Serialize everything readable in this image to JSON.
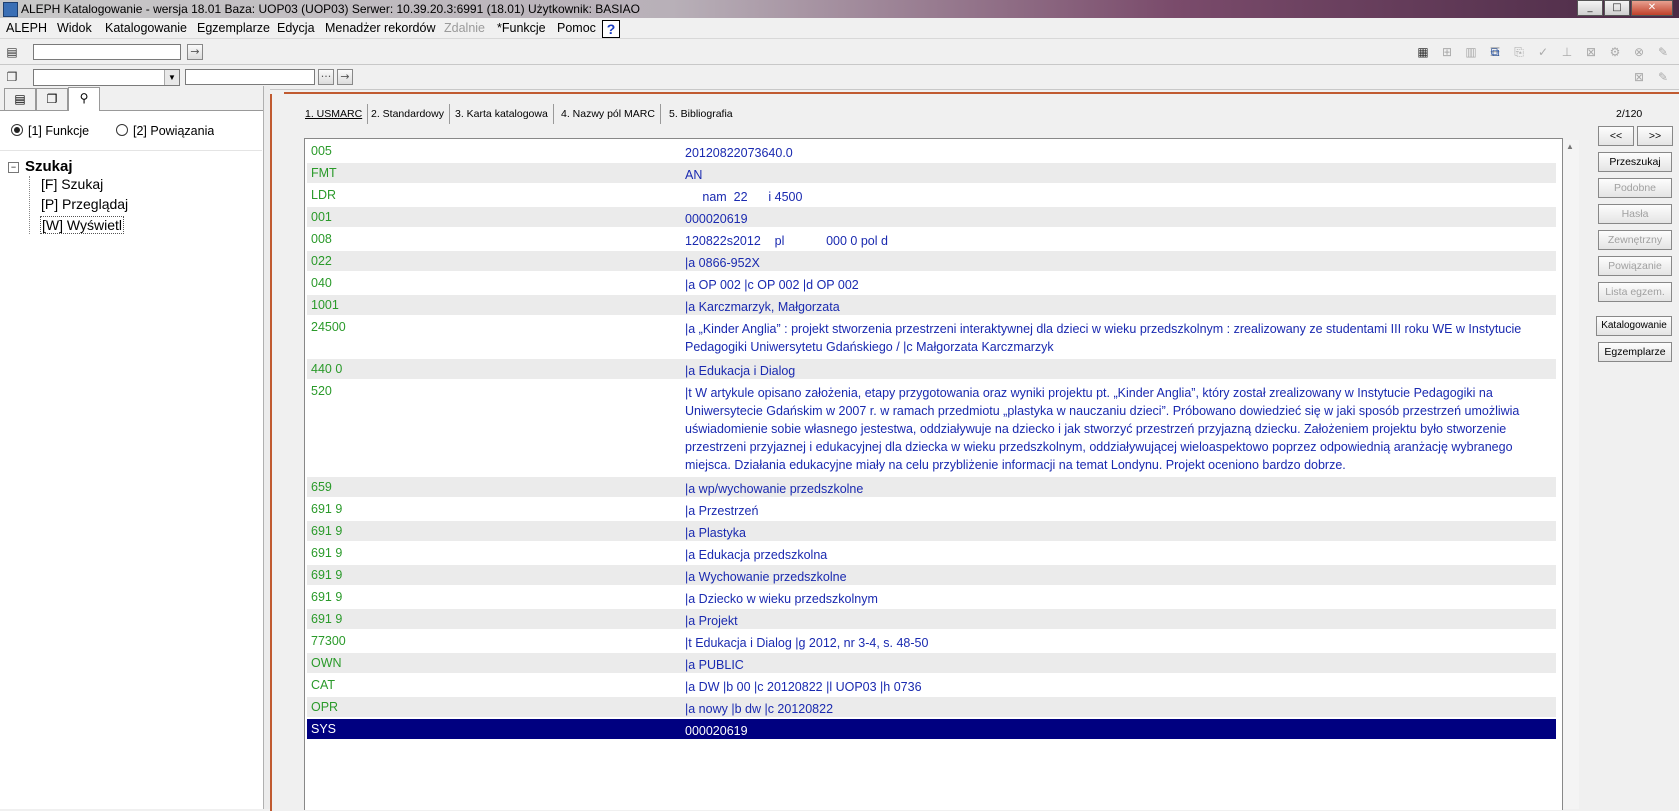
{
  "window": {
    "title": "ALEPH Katalogowanie - wersja 18.01  Baza:  UOP03 (UOP03)  Serwer:  10.39.20.3:6991 (18.01)  Użytkownik:  BASIAO",
    "minimize": "_",
    "restore": "□",
    "close": "✕"
  },
  "menu": {
    "items": [
      "ALEPH",
      "Widok",
      "Katalogowanie",
      "Egzemplarze",
      "Edycja",
      "Menadżer rekordów",
      "Zdalnie",
      "*Funkcje",
      "Pomoc"
    ],
    "help": "?"
  },
  "toolbar": {
    "go_arrow": "→",
    "ellipsis": "···"
  },
  "left": {
    "radio1": "[1] Funkcje",
    "radio2": "[2] Powiązania",
    "tree_root": "Szukaj",
    "tree_items": [
      "[F] Szukaj",
      "[P] Przeglądaj",
      "[W] Wyświetl"
    ]
  },
  "tabs": [
    "1. USMARC",
    "2. Standardowy",
    "3. Karta katalogowa",
    "4. Nazwy pól MARC",
    "5. Bibliografia"
  ],
  "records": [
    {
      "tag": "005",
      "value": "20120822073640.0"
    },
    {
      "tag": "FMT",
      "value": "AN"
    },
    {
      "tag": "LDR",
      "value": "     nam  22      i 4500"
    },
    {
      "tag": "001",
      "value": "000020619"
    },
    {
      "tag": "008",
      "value": "120822s2012    pl            000 0 pol d"
    },
    {
      "tag": "022",
      "value": "|a 0866-952X"
    },
    {
      "tag": "040",
      "value": "|a OP 002 |c OP 002 |d OP 002"
    },
    {
      "tag": "1001",
      "value": "|a Karczmarzyk, Małgorzata"
    },
    {
      "tag": "24500",
      "value": "|a „Kinder Anglia” : projekt stworzenia przestrzeni interaktywnej dla dzieci w wieku przedszkolnym : zrealizowany ze studentami III roku WE w Instytucie Pedagogiki Uniwersytetu Gdańskiego / |c Małgorzata Karczmarzyk"
    },
    {
      "tag": "440 0",
      "value": "|a Edukacja i Dialog"
    },
    {
      "tag": "520",
      "value": "|t W artykule opisano założenia, etapy przygotowania oraz wyniki projektu pt. „Kinder Anglia”, który został zrealizowany w Instytucie Pedagogiki na Uniwersytecie Gdańskim w 2007 r. w ramach przedmiotu „plastyka w nauczaniu dzieci”. Próbowano dowiedzieć się w jaki sposób przestrzeń umożliwia uświadomienie sobie własnego jestestwa, oddziaływuje na dziecko i jak stworzyć przestrzeń przyjazną dziecku. Założeniem projektu było stworzenie przestrzeni przyjaznej i edukacyjnej dla dziecka w wieku przedszkolnym, oddziaływującej wieloaspektowo poprzez odpowiednią aranżację wybranego miejsca. Działania edukacyjne miały na celu przybliżenie informacji na temat Londynu. Projekt oceniono bardzo dobrze."
    },
    {
      "tag": "659",
      "value": "|a wp/wychowanie przedszkolne"
    },
    {
      "tag": "691 9",
      "value": "|a Przestrzeń"
    },
    {
      "tag": "691 9",
      "value": "|a Plastyka"
    },
    {
      "tag": "691 9",
      "value": "|a Edukacja przedszkolna"
    },
    {
      "tag": "691 9",
      "value": "|a Wychowanie przedszkolne"
    },
    {
      "tag": "691 9",
      "value": "|a Dziecko w wieku przedszkolnym"
    },
    {
      "tag": "691 9",
      "value": "|a Projekt"
    },
    {
      "tag": "77300",
      "value": "|t Edukacja i Dialog |g 2012, nr 3-4, s. 48-50"
    },
    {
      "tag": "OWN",
      "value": "|a PUBLIC"
    },
    {
      "tag": "CAT",
      "value": "|a DW |b 00 |c 20120822 |l UOP03 |h 0736"
    },
    {
      "tag": "OPR",
      "value": "|a nowy |b dw |c 20120822"
    },
    {
      "tag": "SYS",
      "value": "000020619"
    }
  ],
  "right": {
    "count": "2/120",
    "prev": "<<",
    "next": ">>",
    "buttons": [
      "Przeszukaj",
      "Podobne",
      "Hasła",
      "Zewnętrzny",
      "Powiązanie",
      "Lista egzem.",
      "Katalogowanie",
      "Egzemplarze"
    ]
  }
}
